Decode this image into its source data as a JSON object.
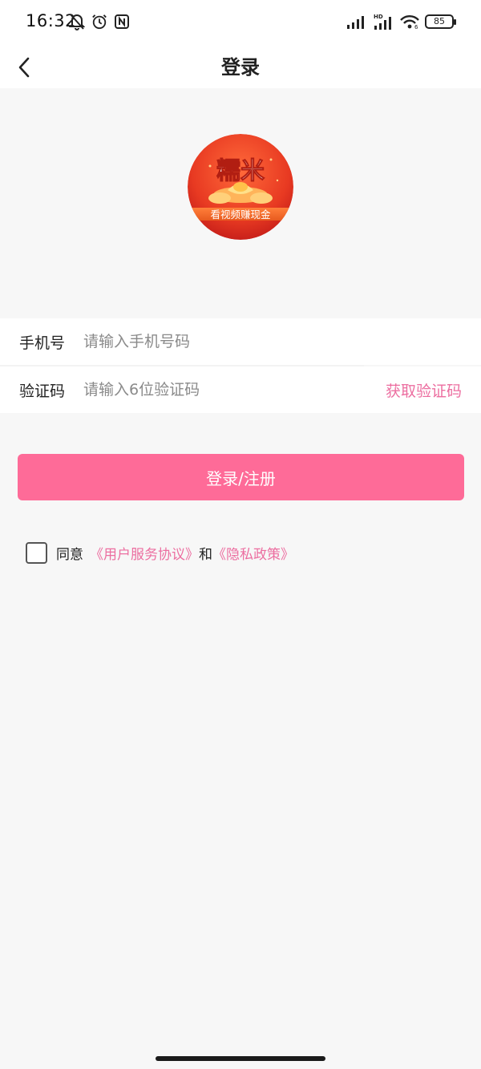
{
  "status_bar": {
    "time": "16:32",
    "battery": "85",
    "icons": [
      "mute-bell-icon",
      "alarm-icon",
      "nfc-icon",
      "signal-icon",
      "hd-signal-icon",
      "wifi-icon",
      "battery-icon"
    ]
  },
  "header": {
    "title": "登录",
    "back_icon": "chevron-left-icon"
  },
  "logo": {
    "name": "糯米",
    "tagline": "看视频赚现金"
  },
  "form": {
    "phone_label": "手机号",
    "phone_placeholder": "请输入手机号码",
    "phone_value": "",
    "code_label": "验证码",
    "code_placeholder": "请输入6位验证码",
    "code_value": "",
    "get_code_label": "获取验证码"
  },
  "login_button": "登录/注册",
  "agreement": {
    "checked": false,
    "prefix": "同意",
    "user_agreement": "《用户服务协议》",
    "and": "和",
    "privacy_policy": "《隐私政策》"
  },
  "colors": {
    "accent": "#fe6b98",
    "link": "#ec6ea0",
    "background": "#f7f7f7"
  }
}
